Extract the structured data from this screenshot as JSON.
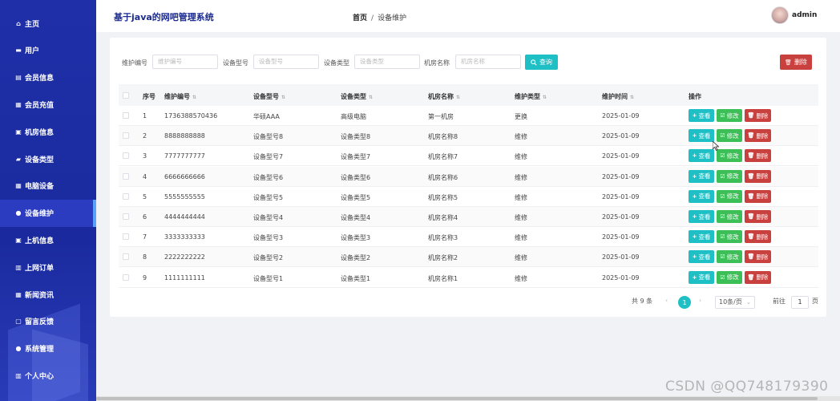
{
  "app": {
    "title": "基于java的网吧管理系统",
    "user": "admin"
  },
  "breadcrumb": {
    "home": "首页",
    "separator": "/",
    "current": "设备维护"
  },
  "sidebar": {
    "items": [
      {
        "label": "主页",
        "icon": "home-icon"
      },
      {
        "label": "用户",
        "icon": "user-card-icon"
      },
      {
        "label": "会员信息",
        "icon": "list-icon"
      },
      {
        "label": "会员充值",
        "icon": "grid-icon"
      },
      {
        "label": "机房信息",
        "icon": "monitor-icon"
      },
      {
        "label": "设备类型",
        "icon": "briefcase-icon"
      },
      {
        "label": "电脑设备",
        "icon": "grid-icon"
      },
      {
        "label": "设备维护",
        "icon": "person-icon",
        "active": true
      },
      {
        "label": "上机信息",
        "icon": "monitor-icon"
      },
      {
        "label": "上网订单",
        "icon": "document-icon"
      },
      {
        "label": "新闻资讯",
        "icon": "grid-icon"
      },
      {
        "label": "留言反馈",
        "icon": "chat-icon"
      },
      {
        "label": "系统管理",
        "icon": "person-icon"
      },
      {
        "label": "个人中心",
        "icon": "document-icon"
      }
    ]
  },
  "search": {
    "fields": [
      {
        "label": "维护编号",
        "placeholder": "维护编号"
      },
      {
        "label": "设备型号",
        "placeholder": "设备型号"
      },
      {
        "label": "设备类型",
        "placeholder": "设备类型"
      },
      {
        "label": "机房名称",
        "placeholder": "机房名称"
      }
    ],
    "search_label": "查询",
    "delete_label": "删除"
  },
  "table": {
    "columns": [
      "序号",
      "维护编号",
      "设备型号",
      "设备类型",
      "机房名称",
      "维护类型",
      "维护时间",
      "操作"
    ],
    "rows": [
      {
        "no": "1",
        "code": "1736388570436",
        "model": "华硕AAA",
        "type": "高级电脑",
        "room": "第一机房",
        "mtype": "更换",
        "date": "2025-01-09"
      },
      {
        "no": "2",
        "code": "8888888888",
        "model": "设备型号8",
        "type": "设备类型8",
        "room": "机房名称8",
        "mtype": "维修",
        "date": "2025-01-09"
      },
      {
        "no": "3",
        "code": "7777777777",
        "model": "设备型号7",
        "type": "设备类型7",
        "room": "机房名称7",
        "mtype": "维修",
        "date": "2025-01-09"
      },
      {
        "no": "4",
        "code": "6666666666",
        "model": "设备型号6",
        "type": "设备类型6",
        "room": "机房名称6",
        "mtype": "维修",
        "date": "2025-01-09"
      },
      {
        "no": "5",
        "code": "5555555555",
        "model": "设备型号5",
        "type": "设备类型5",
        "room": "机房名称5",
        "mtype": "维修",
        "date": "2025-01-09"
      },
      {
        "no": "6",
        "code": "4444444444",
        "model": "设备型号4",
        "type": "设备类型4",
        "room": "机房名称4",
        "mtype": "维修",
        "date": "2025-01-09"
      },
      {
        "no": "7",
        "code": "3333333333",
        "model": "设备型号3",
        "type": "设备类型3",
        "room": "机房名称3",
        "mtype": "维修",
        "date": "2025-01-09"
      },
      {
        "no": "8",
        "code": "2222222222",
        "model": "设备型号2",
        "type": "设备类型2",
        "room": "机房名称2",
        "mtype": "维修",
        "date": "2025-01-09"
      },
      {
        "no": "9",
        "code": "1111111111",
        "model": "设备型号1",
        "type": "设备类型1",
        "room": "机房名称1",
        "mtype": "维修",
        "date": "2025-01-09"
      }
    ],
    "actions": {
      "view": "查看",
      "edit": "修改",
      "delete": "删除"
    }
  },
  "pagination": {
    "total": "共 9 条",
    "current_page": "1",
    "page_size": "10条/页",
    "goto_prefix": "前往",
    "goto_value": "1",
    "goto_suffix": "页"
  },
  "watermark": "CSDN @QQ748179390",
  "colors": {
    "sidebar": "#1f2fa8",
    "accent": "#1ec0c6",
    "edit": "#3cbf57",
    "danger": "#c9413f"
  }
}
